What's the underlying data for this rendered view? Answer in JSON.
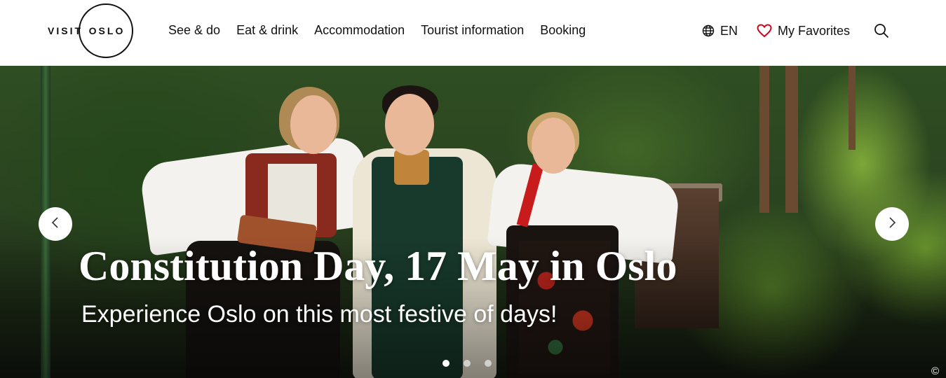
{
  "header": {
    "logo": {
      "visit": "VISIT",
      "oslo": "OSLO"
    },
    "nav": [
      {
        "label": "See & do"
      },
      {
        "label": "Eat & drink"
      },
      {
        "label": "Accommodation"
      },
      {
        "label": "Tourist information"
      },
      {
        "label": "Booking"
      }
    ],
    "language": {
      "label": "EN",
      "icon": "globe-icon"
    },
    "favorites": {
      "label": "My Favorites",
      "icon": "heart-icon",
      "icon_color": "#d0021b"
    },
    "search": {
      "icon": "search-icon"
    }
  },
  "hero": {
    "title": "Constitution Day, 17 May in Oslo",
    "subtitle": "Experience Oslo on this most festive of days!",
    "prev_icon": "chevron-left-icon",
    "next_icon": "chevron-right-icon",
    "slides_total": 3,
    "active_slide": 1,
    "copyright": "©"
  }
}
